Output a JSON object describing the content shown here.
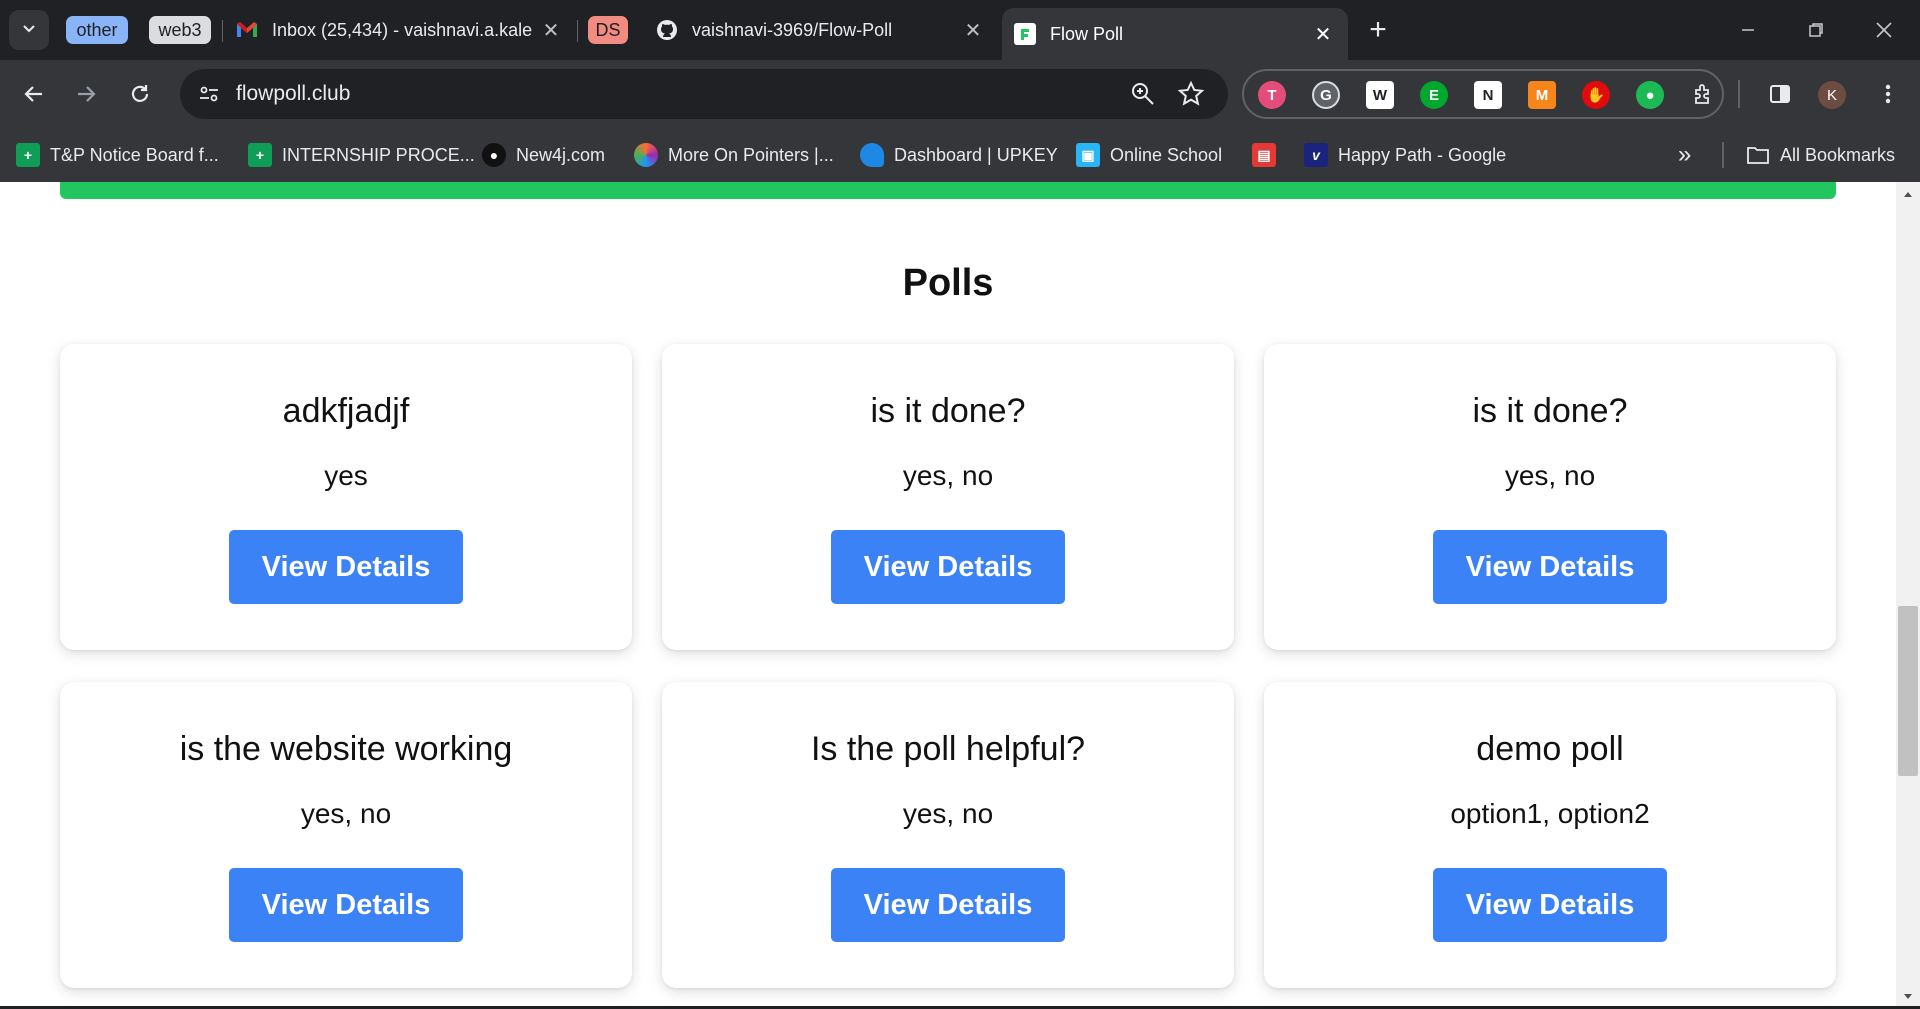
{
  "browser": {
    "tab_groups": [
      {
        "label": "other",
        "color": "#8ab4f8"
      },
      {
        "label": "web3",
        "color": "#dadce0"
      },
      {
        "label": "DS",
        "color": "#f28b82"
      }
    ],
    "tabs": [
      {
        "title": "Inbox (25,434) - vaishnavi.a.kale",
        "icon": "gmail-icon",
        "close": "✕"
      },
      {
        "title": "vaishnavi-3969/Flow-Poll",
        "icon": "github-icon",
        "close": "✕"
      },
      {
        "title": "Flow Poll",
        "icon": "flowpoll-favicon",
        "close": "✕",
        "active": true
      }
    ],
    "new_tab": "+",
    "url": "flowpoll.club",
    "profile_initial": "K",
    "extensions": [
      "todoist",
      "grammarly",
      "wordtune",
      "evernote",
      "notion",
      "metamask",
      "adblock",
      "recorder",
      "extensions-puzzle"
    ],
    "bookmarks": [
      {
        "label": "T&P Notice Board f...",
        "icon": "sheets-icon",
        "color": "#0f9d58"
      },
      {
        "label": "INTERNSHIP PROCE...",
        "icon": "sheets-icon",
        "color": "#0f9d58"
      },
      {
        "label": "New4j.com",
        "icon": "neo4j-icon",
        "color": "#111111"
      },
      {
        "label": "More On Pointers |...",
        "icon": "pointers-icon",
        "color": "#ff6b35"
      },
      {
        "label": "Dashboard | UPKEY",
        "icon": "upkey-icon",
        "color": "#1e88e5"
      },
      {
        "label": "Online School",
        "icon": "cube-icon",
        "color": "#29b6f6"
      },
      {
        "label": "",
        "icon": "store-icon",
        "color": "#e53935"
      },
      {
        "label": "Happy Path - Google",
        "icon": "happypath-icon",
        "color": "#1a237e"
      }
    ],
    "more_bookmarks": "»",
    "all_bookmarks": "All Bookmarks"
  },
  "page": {
    "heading": "Polls",
    "polls": [
      {
        "question": "adkfjadjf",
        "options": "yes",
        "button": "View Details"
      },
      {
        "question": "is it done?",
        "options": "yes, no",
        "button": "View Details"
      },
      {
        "question": "is it done?",
        "options": "yes, no",
        "button": "View Details"
      },
      {
        "question": "is the website working",
        "options": "yes, no",
        "button": "View Details"
      },
      {
        "question": "Is the poll helpful?",
        "options": "yes, no",
        "button": "View Details"
      },
      {
        "question": "demo poll",
        "options": "option1, option2",
        "button": "View Details"
      }
    ],
    "colors": {
      "accent": "#3b82f6",
      "banner": "#22c55e"
    }
  }
}
